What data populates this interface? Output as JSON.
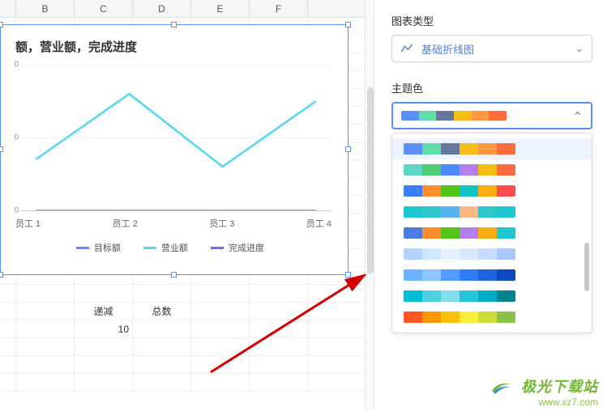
{
  "columns": [
    "",
    "B",
    "C",
    "D",
    "E",
    "F"
  ],
  "table": {
    "headers": [
      "递减",
      "总数"
    ],
    "value_cell": "10"
  },
  "panel": {
    "chart_type_label": "图表类型",
    "chart_type_value": "基础折线图",
    "theme_label": "主题色"
  },
  "chart_data": {
    "type": "line",
    "title": "额，营业额，完成进度",
    "categories": [
      "员工 1",
      "员工 2",
      "员工 3",
      "员工 4"
    ],
    "y_ticks": [
      "0",
      "0",
      "0"
    ],
    "ylim": [
      0,
      100
    ],
    "series": [
      {
        "name": "目标额",
        "color": "#5b8ff9",
        "values": [
          0,
          0,
          0,
          0
        ]
      },
      {
        "name": "营业额",
        "color": "#61ddaa",
        "values": [
          35,
          80,
          30,
          75
        ]
      },
      {
        "name": "完成进度",
        "color": "#7666f9",
        "values": [
          0,
          0,
          0,
          0
        ]
      }
    ],
    "legend": [
      {
        "label": "目标额",
        "color": "#5b8ff9"
      },
      {
        "label": "营业额",
        "color": "#5ad8f0"
      },
      {
        "label": "完成进度",
        "color": "#7666f9"
      }
    ]
  },
  "palettes": {
    "selected": [
      "#5b8ff9",
      "#61ddaa",
      "#65789b",
      "#f6bd16",
      "#ff9845",
      "#ff6b3b"
    ],
    "options": [
      [
        "#5b8ff9",
        "#61ddaa",
        "#65789b",
        "#f6bd16",
        "#ff9845",
        "#ff6b3b"
      ],
      [
        "#5dd5c8",
        "#4ecb73",
        "#4b8bff",
        "#b37feb",
        "#f6bd16",
        "#ff6b3b"
      ],
      [
        "#3a7fff",
        "#ff8c2e",
        "#53c41a",
        "#13c2c2",
        "#faad14",
        "#ff4d4f"
      ],
      [
        "#1cc7d0",
        "#2ec7c9",
        "#5ab1ef",
        "#ffb980",
        "#2ec7c9",
        "#1cc7d0"
      ],
      [
        "#4b7de3",
        "#ff8c2e",
        "#53c41a",
        "#b37feb",
        "#faad14",
        "#1cc7d0"
      ],
      [
        "#b3d4ff",
        "#cfe8ff",
        "#e6f0ff",
        "#d9e8ff",
        "#c7dcff",
        "#a8c8ff"
      ],
      [
        "#6bb3ff",
        "#8dc6ff",
        "#4f9bff",
        "#2f7dff",
        "#1e63e0",
        "#0c49c0"
      ],
      [
        "#00bcd4",
        "#4dd0e1",
        "#80deea",
        "#26c6da",
        "#00acc1",
        "#00838f"
      ],
      [
        "#ff5722",
        "#ff9800",
        "#ffc107",
        "#ffeb3b",
        "#cddc39",
        "#8bc34a"
      ]
    ]
  },
  "watermark": {
    "brand": "极光下载站",
    "url": "www.xz7.com"
  }
}
